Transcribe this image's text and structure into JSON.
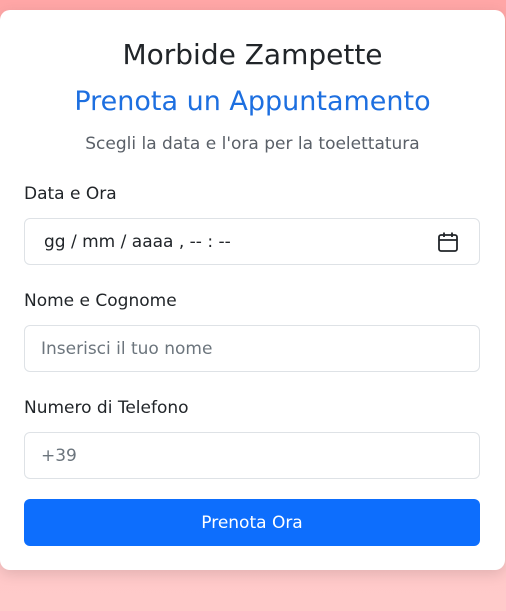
{
  "header": {
    "brand": "Morbide Zampette",
    "title": "Prenota un Appuntamento",
    "description": "Scegli la data e l'ora per la toelettatura"
  },
  "form": {
    "datetime": {
      "label": "Data e Ora",
      "placeholder": "gg / mm / aaaa ,  -- : --"
    },
    "name": {
      "label": "Nome e Cognome",
      "placeholder": "Inserisci il tuo nome"
    },
    "phone": {
      "label": "Numero di Telefono",
      "value": "+39"
    },
    "submit_label": "Prenota Ora"
  },
  "colors": {
    "accent": "#0d6efd",
    "title": "#1d6fe0"
  },
  "icons": {
    "datetime": "calendar-icon"
  }
}
